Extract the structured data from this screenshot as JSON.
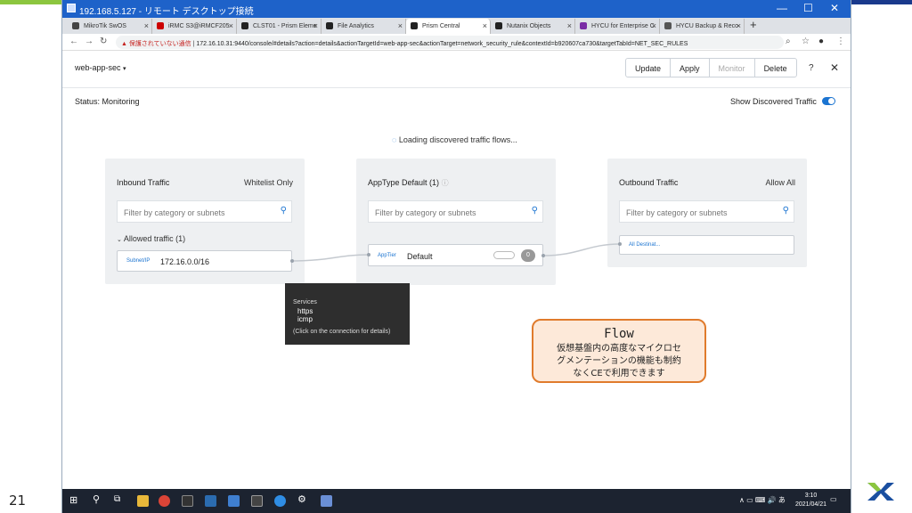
{
  "slide": {
    "page_number": "21"
  },
  "window": {
    "title": "192.168.5.127 - リモート デスクトップ接続",
    "controls": [
      "—",
      "☐",
      "✕"
    ]
  },
  "browser": {
    "tabs": [
      {
        "label": "MikroTik SwOS",
        "fav": "#444"
      },
      {
        "label": "iRMC S3@iRMCF205",
        "fav": "#c00"
      },
      {
        "label": "CLST01 - Prism Eleme",
        "fav": "#222"
      },
      {
        "label": "File Analytics",
        "fav": "#222"
      },
      {
        "label": "Prism Central",
        "fav": "#222",
        "active": true
      },
      {
        "label": "Nutanix Objects",
        "fav": "#222"
      },
      {
        "label": "HYCU for Enterprise C",
        "fav": "#7a2ca5"
      },
      {
        "label": "HYCU Backup & Reco",
        "fav": "#555"
      }
    ],
    "new_tab": "+",
    "security_warning": "保護されていない通信",
    "url": "172.16.10.31:9440/console/#details?action=details&actionTargetId=web-app-sec&actionTarget=network_security_rule&contextId=b920607ca730&targetTabId=NET_SEC_RULES"
  },
  "app": {
    "policy_name": "web-app-sec",
    "actions": {
      "update": "Update",
      "apply": "Apply",
      "monitor": "Monitor",
      "delete": "Delete"
    },
    "help": "?",
    "close": "✕",
    "status_label": "Status:",
    "status_value": "Monitoring",
    "show_discovered": "Show Discovered Traffic",
    "loading": "Loading discovered traffic flows..."
  },
  "inbound": {
    "title": "Inbound Traffic",
    "mode": "Whitelist Only",
    "filter_placeholder": "Filter by category or subnets",
    "allowed": "Allowed traffic (1)",
    "node_tag": "Subnet/IP",
    "node_value": "172.16.0.0/16"
  },
  "apptype": {
    "title": "AppType Default (1)",
    "filter_placeholder": "Filter by category or subnets",
    "node_tag": "AppTier",
    "node_value": "Default",
    "count": "0"
  },
  "outbound": {
    "title": "Outbound Traffic",
    "mode": "Allow All",
    "filter_placeholder": "Filter by category or subnets",
    "node_value": "All Destinat..."
  },
  "tooltip": {
    "heading": "Services",
    "line1": "https",
    "line2": "icmp",
    "hint": "(Click on the connection for details)"
  },
  "callout": {
    "title": "Flow",
    "body1": "仮想基盤内の高度なマイクロセ",
    "body2": "グメンテーションの機能も制約",
    "body3": "なくCEで利用できます"
  },
  "taskbar": {
    "time": "3:10",
    "date": "2021/04/21",
    "tray": "∧ ▭ ⌨ 🔊 あ"
  }
}
